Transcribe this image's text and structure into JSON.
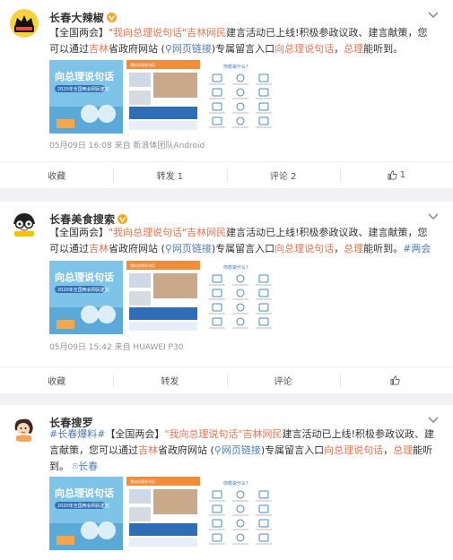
{
  "posts": [
    {
      "author": "长春大辣椒",
      "text": {
        "p1": "【全国两会】",
        "h1": "\"我向总理说句话\"吉林网民",
        "p2": "建言活动已上线!积极参政议政、建言献策，您可以通过",
        "h2": "吉林",
        "p3": "省政府网站 (",
        "link": "网页链接",
        "p4": ")专属留言入口",
        "h3": "向总理说句话",
        "p5": "，",
        "h4": "总理",
        "p6": "能听到。"
      },
      "meta": "05月09日 16:08  来自 新浪体团队Android",
      "actions": {
        "fav": "收藏",
        "repost": "转发 1",
        "comment": "评论 2",
        "like": "1"
      }
    },
    {
      "author": "长春美食搜索",
      "text": {
        "p1": "【全国两会】",
        "h1": "\"我向总理说句话\"吉林网民",
        "p2": "建言活动已上线!积极参政议政、建言献策，您可以通过",
        "h2": "吉林",
        "p3": "省政府网站 (",
        "link": "网页链接",
        "p4": ")专属留言入口",
        "h3": "向总理说句话",
        "p5": "，",
        "h4": "总理",
        "p6": "能听到。",
        "tag": "#两会#"
      },
      "meta": "05月09日 15:42  来自 HUAWEI P30",
      "actions": {
        "fav": "收藏",
        "repost": "转发",
        "comment": "评论",
        "like": ""
      }
    },
    {
      "author": "长春搜罗",
      "text": {
        "tag": "#长春爆料#",
        "p1": "【全国两会】",
        "h1": "\"我向总理说句话\"吉林网民",
        "p2": "建言活动已上线!积极参政议政、建言献策，您可以通过",
        "h2": "吉林",
        "p3": "省政府网站 (",
        "link": "网页链接",
        "p4": ")专属留言入口",
        "h3": "向总理说句话",
        "p5": "，",
        "h4": "总理",
        "p6": "能听到。",
        "loc": "长春"
      }
    }
  ],
  "image_text": {
    "poster_title": "向总理说句话",
    "poster_sub": "2020年全国两会网民建言",
    "page_header": "我向总理说句话",
    "menu_title": "你想说什么？"
  },
  "icons": [
    "verified-badge-icon",
    "chevron-down-icon",
    "thumb-up-icon",
    "link-icon",
    "location-icon"
  ],
  "colors": {
    "highlight": "#eb7350",
    "link": "#507daf",
    "badge": "#f5a623",
    "meta": "#939393"
  }
}
